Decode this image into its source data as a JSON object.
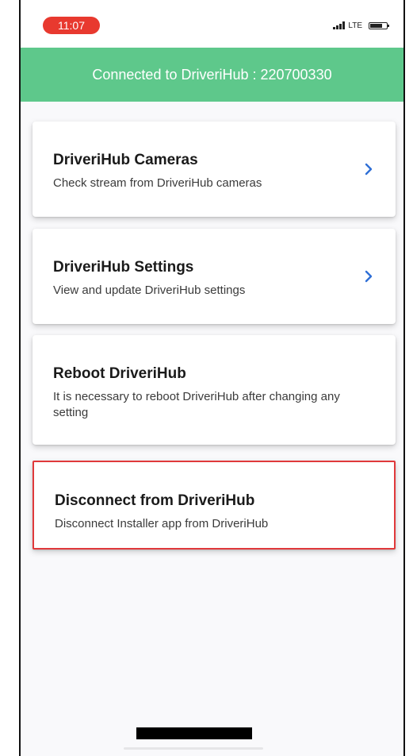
{
  "status_bar": {
    "time": "11:07",
    "network": "LTE",
    "icons": [
      "signal-icon",
      "battery-icon"
    ],
    "time_pill_color": "#e8392f"
  },
  "header": {
    "text": "Connected to DriveriHub : 220700330",
    "background_color": "#5ec88b"
  },
  "menu": {
    "items": [
      {
        "title": "DriveriHub Cameras",
        "subtitle": "Check stream from DriveriHub cameras",
        "icon": "chevron-right-icon"
      },
      {
        "title": "DriveriHub Settings",
        "subtitle": "View and update DriveriHub settings",
        "icon": "chevron-right-icon"
      },
      {
        "title": "Reboot DriveriHub",
        "subtitle": "It is necessary to reboot DriveriHub after changing any setting"
      },
      {
        "title": "Disconnect from DriveriHub",
        "subtitle": "Disconnect Installer app from DriveriHub",
        "highlight_color": "#e0393b"
      }
    ]
  },
  "colors": {
    "chevron": "#2f6fd6"
  }
}
